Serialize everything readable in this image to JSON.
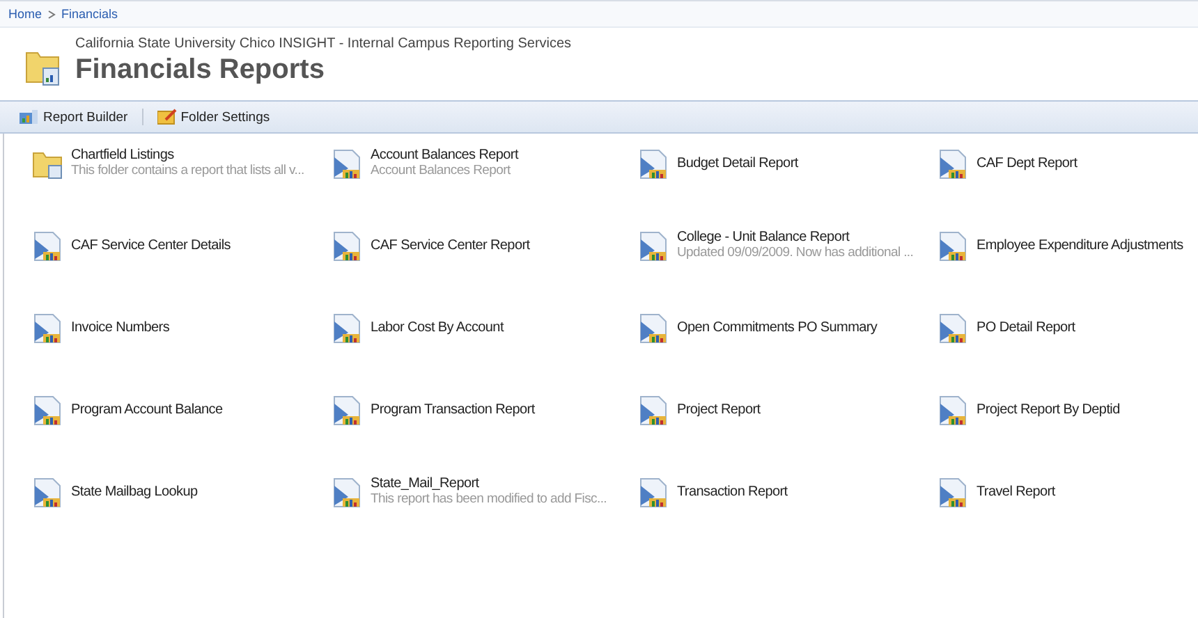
{
  "breadcrumb": [
    "Home",
    "Financials"
  ],
  "header": {
    "subtitle": "California State University Chico INSIGHT - Internal Campus Reporting Services",
    "title": "Financials Reports"
  },
  "toolbar": [
    {
      "label": "Report Builder",
      "kind": "builder"
    },
    {
      "label": "Folder Settings",
      "kind": "settings"
    }
  ],
  "items": [
    {
      "kind": "folder",
      "name": "Chartfield Listings",
      "description": "This folder contains a report that lists all v..."
    },
    {
      "kind": "report",
      "name": "Account Balances Report",
      "description": "Account Balances Report"
    },
    {
      "kind": "report",
      "name": "Budget Detail Report"
    },
    {
      "kind": "report",
      "name": "CAF Dept Report"
    },
    {
      "kind": "report",
      "name": "CAF Service Center Details"
    },
    {
      "kind": "report",
      "name": "CAF Service Center Report"
    },
    {
      "kind": "report",
      "name": "College - Unit Balance Report",
      "description": "Updated 09/09/2009. Now has additional ..."
    },
    {
      "kind": "report",
      "name": "Employee Expenditure Adjustments"
    },
    {
      "kind": "report",
      "name": "Invoice Numbers"
    },
    {
      "kind": "report",
      "name": "Labor Cost By Account"
    },
    {
      "kind": "report",
      "name": "Open Commitments PO Summary"
    },
    {
      "kind": "report",
      "name": "PO Detail Report"
    },
    {
      "kind": "report",
      "name": "Program Account Balance"
    },
    {
      "kind": "report",
      "name": "Program Transaction Report"
    },
    {
      "kind": "report",
      "name": "Project Report"
    },
    {
      "kind": "report",
      "name": "Project Report By Deptid"
    },
    {
      "kind": "report",
      "name": "State Mailbag Lookup"
    },
    {
      "kind": "report",
      "name": "State_Mail_Report",
      "description": "This report has been modified to add Fisc..."
    },
    {
      "kind": "report",
      "name": "Transaction Report"
    },
    {
      "kind": "report",
      "name": "Travel Report"
    }
  ]
}
